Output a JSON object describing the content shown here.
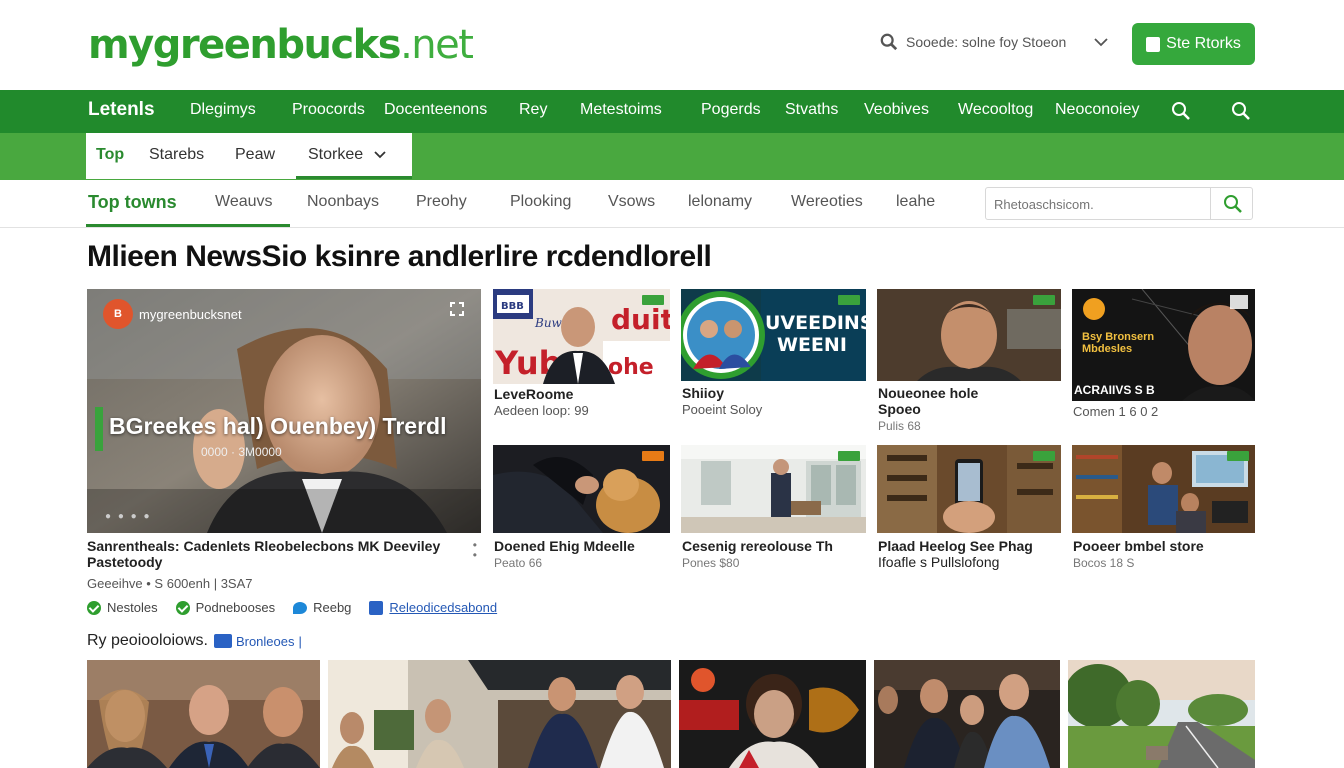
{
  "header": {
    "logo_part1": "mygreenbucks",
    "logo_part2": ".net",
    "search_placeholder": "Sooede: solne foy Stoeon",
    "store_button_label": "Ste Rtorks"
  },
  "main_nav": {
    "items": [
      "Letenls",
      "Dlegimys",
      "Proocords",
      "Docenteenons",
      "Rey",
      "Metestoims",
      "Pogerds",
      "Stvaths",
      "Veobives",
      "Wecooltog",
      "Neoconoiey"
    ]
  },
  "sub_tabs": {
    "items": [
      "Top",
      "Starebs",
      "Peaw",
      "Storkee"
    ]
  },
  "category_bar": {
    "items": [
      "Top towns",
      "Weauvs",
      "Noonbays",
      "Preohy",
      "Plooking",
      "Vsows",
      "lelonamy",
      "Wereoties",
      "leahe"
    ],
    "search_placeholder": "Rhetoaschsicom."
  },
  "page_title": "Mlieen NewsSio ksinre andlerlire rcdendlorell",
  "feature": {
    "brand": "mygreenbucksnet",
    "badge": "B",
    "title": "BGreekes hal) Ouenbey) Trerdl",
    "subtitle": "0000 · 3M0000",
    "caption_title": "Sanrentheals: Cadenlets Rleobelecbons MK Deeviley Pastetoody",
    "caption_meta": "Geeeihve • S 600enh | 3SA7"
  },
  "grid_row1": [
    {
      "title": "LeveRoome",
      "meta": "Aedeen loop: 99",
      "overlay": "Buw..., Yub... ohe"
    },
    {
      "title": "Shiioy",
      "meta": "Pooeint Soloy",
      "overlay": "UVEEDINS WEENI"
    },
    {
      "title": "Noueonee hole",
      "meta": "Spoeo",
      "meta2": "Pulis 68"
    },
    {
      "title": "Comen 1 6 0 2",
      "overlay": "ACRAIIVS S B",
      "overlay2": "Bsy Bronsern Mbdesles"
    }
  ],
  "grid_row2": [
    {
      "title": "Doened Ehig Mdeelle",
      "meta": "Peato 66"
    },
    {
      "title": "Cesenig rereolouse Th",
      "meta": "Pones $80"
    },
    {
      "title": "Plaad Heelog See Phag",
      "meta": "Ifoafle s Pullslofong"
    },
    {
      "title": "Pooeer bmbel store",
      "meta": "Bocos 18 S"
    }
  ],
  "tags": [
    "Nestoles",
    "Podnebooses",
    "Reebg",
    "Releodicedsabond"
  ],
  "section2": {
    "title": "Ry peoiooloiows.",
    "link": "Bronleoes"
  },
  "colors": {
    "brand_green": "#2f9e2f",
    "nav_green": "#218a2c",
    "subbar_green": "#49a83f",
    "button_green": "#35a83c",
    "link_blue": "#2458b5"
  }
}
